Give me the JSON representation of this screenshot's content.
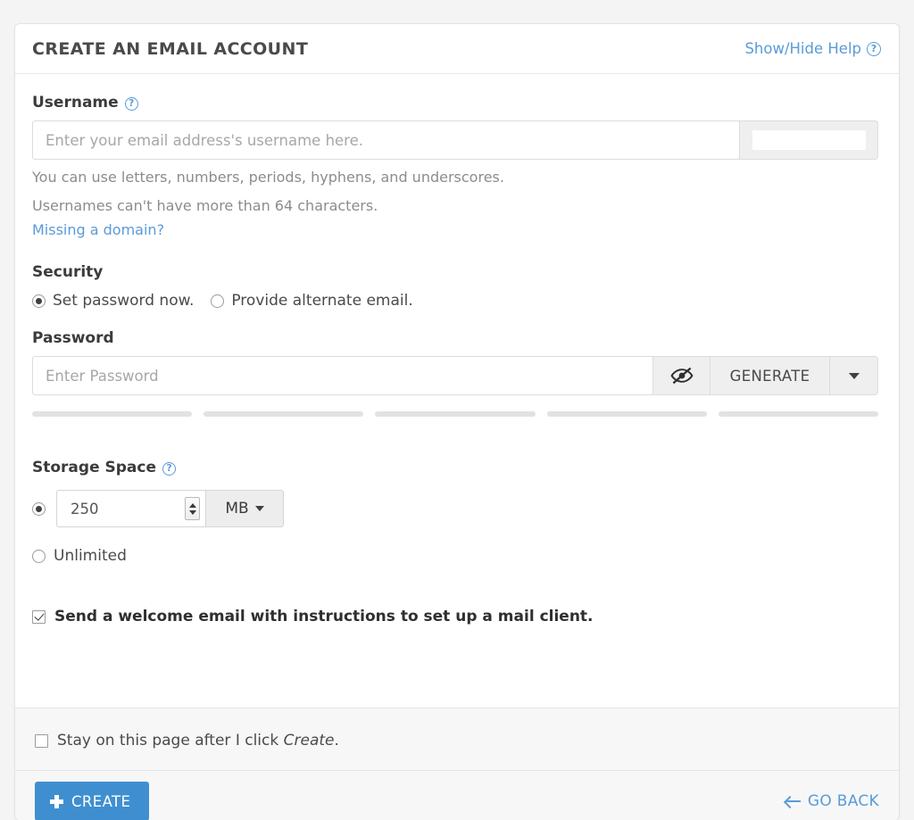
{
  "header": {
    "title": "CREATE AN EMAIL ACCOUNT",
    "help_toggle_label": "Show/Hide Help",
    "help_icon_glyph": "?"
  },
  "username": {
    "label": "Username",
    "help_icon_glyph": "?",
    "placeholder": "Enter your email address's username here.",
    "value": "",
    "domain_value": "",
    "hint_line_1": "You can use letters, numbers, periods, hyphens, and underscores.",
    "hint_line_2": "Usernames can't have more than 64 characters.",
    "missing_domain_link": "Missing a domain?"
  },
  "security": {
    "title": "Security",
    "options": [
      {
        "label": "Set password now.",
        "selected": true
      },
      {
        "label": "Provide alternate email.",
        "selected": false
      }
    ]
  },
  "password": {
    "label": "Password",
    "placeholder": "Enter Password",
    "value": "",
    "toggle_icon": "eye-slash-icon",
    "generate_label": "GENERATE",
    "caret_icon": "chevron-down-icon",
    "strength_segments": 5,
    "strength_filled": 0,
    "empty_color": "#e2e2e2"
  },
  "storage": {
    "label": "Storage Space",
    "help_icon_glyph": "?",
    "quota_selected": true,
    "quota_value": "250",
    "unit_value": "MB",
    "unlimited_label": "Unlimited",
    "unlimited_selected": false
  },
  "welcome": {
    "label": "Send a welcome email with instructions to set up a mail client.",
    "checked": true
  },
  "footer": {
    "stay_label_before": "Stay on this page after I click ",
    "stay_label_emphasis": "Create",
    "stay_label_after": ".",
    "stay_checked": false,
    "create_label": "CREATE",
    "go_back_label": "GO BACK"
  },
  "colors": {
    "accent_blue": "#3f8fd0",
    "link_blue": "#5a9bd8",
    "page_background": "#f4f4f4",
    "card_background": "#ffffff",
    "footer_background": "#f7f7f7"
  }
}
